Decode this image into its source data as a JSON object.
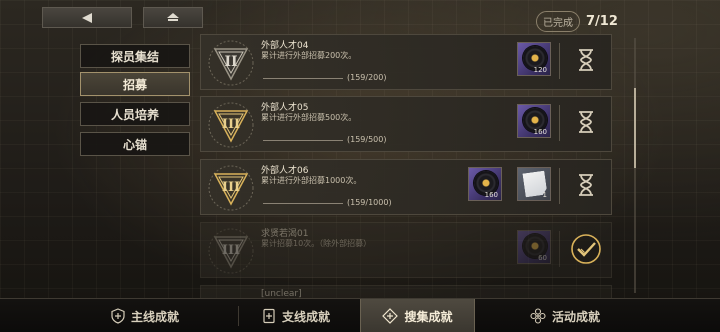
{
  "header": {
    "completion_label": "已完成",
    "completion_value": "7/12"
  },
  "categories": [
    {
      "label": "探员集结",
      "active": false
    },
    {
      "label": "招募",
      "active": true
    },
    {
      "label": "人员培养",
      "active": false
    },
    {
      "label": "心锚",
      "active": false
    }
  ],
  "tasks": [
    {
      "title": "外部人才04",
      "desc": "累计进行外部招募200次。",
      "progress": "(159/200)",
      "progress_fraction": 0.795,
      "rank": "II",
      "rewards": [
        {
          "icon": "vinyl-record-icon",
          "qty": "120"
        }
      ],
      "status": "in-progress"
    },
    {
      "title": "外部人才05",
      "desc": "累计进行外部招募500次。",
      "progress": "(159/500)",
      "progress_fraction": 0.318,
      "rank": "III",
      "rewards": [
        {
          "icon": "vinyl-record-icon",
          "qty": "160"
        }
      ],
      "status": "in-progress"
    },
    {
      "title": "外部人才06",
      "desc": "累计进行外部招募1000次。",
      "progress": "(159/1000)",
      "progress_fraction": 0.159,
      "rank": "III",
      "rewards": [
        {
          "icon": "vinyl-record-icon",
          "qty": "160"
        },
        {
          "icon": "paper-sheet-icon",
          "qty": "1"
        }
      ],
      "status": "in-progress"
    },
    {
      "title": "求贤若渴01",
      "desc": "累计招募10次。（除外部招募）",
      "progress": "",
      "rank": "III",
      "rewards": [
        {
          "icon": "vinyl-record-icon",
          "qty": "60"
        }
      ],
      "status": "completed"
    },
    {
      "title": "[unclear]",
      "desc": "",
      "progress": "",
      "rank": "",
      "rewards": [],
      "status": ""
    }
  ],
  "tabs": [
    {
      "label": "主线成就",
      "icon": "shield-plus-icon",
      "active": false
    },
    {
      "label": "支线成就",
      "icon": "card-plus-icon",
      "active": false
    },
    {
      "label": "搜集成就",
      "icon": "diamond-plus-icon",
      "active": true
    },
    {
      "label": "活动成就",
      "icon": "flower-plus-icon",
      "active": false
    }
  ],
  "colors": {
    "accent_gold": "#d9b25a",
    "text_main": "#ece3cf",
    "active_tab": "#4f4a40"
  }
}
